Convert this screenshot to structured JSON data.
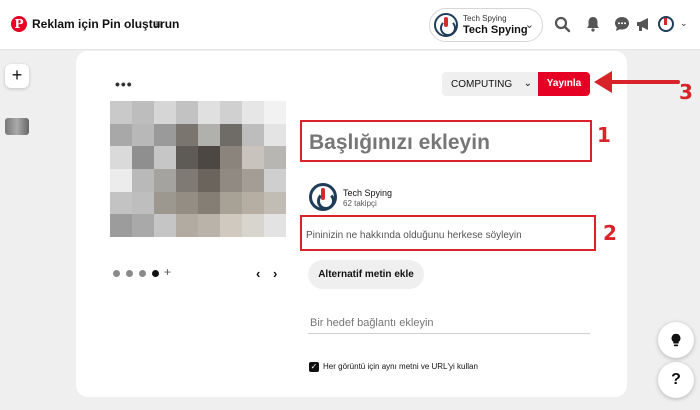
{
  "header": {
    "app_title": "Reklam için Pin oluşturun",
    "account": {
      "small_label": "Tech Spying",
      "name": "Tech Spying"
    }
  },
  "editor": {
    "board_select": "COMPUTING",
    "publish_label": "Yayınla",
    "title_placeholder": "Başlığınızı ekleyin",
    "owner": {
      "name": "Tech Spying",
      "followers": "62 takipçi"
    },
    "description_placeholder": "Pininizin ne hakkında olduğunu herkese söyleyin",
    "alt_text_button": "Alternatif metin ekle",
    "link_placeholder": "Bir hedef bağlantı ekleyin",
    "same_text_checkbox_label": "Her görüntü için aynı metni ve URL'yi kullan",
    "carousel": {
      "count": 4,
      "active_index": 3
    }
  },
  "annotations": {
    "one": "1",
    "two": "2",
    "three": "3"
  },
  "colors": {
    "accent": "#e60023",
    "annotation": "#d8232a",
    "page_bg": "#efefef"
  },
  "icons": [
    "pinterest-logo-icon",
    "menu-icon",
    "search-icon",
    "bell-icon",
    "chat-icon",
    "megaphone-icon",
    "plus-icon",
    "chevron-down-icon",
    "lightbulb-icon",
    "help-icon"
  ]
}
